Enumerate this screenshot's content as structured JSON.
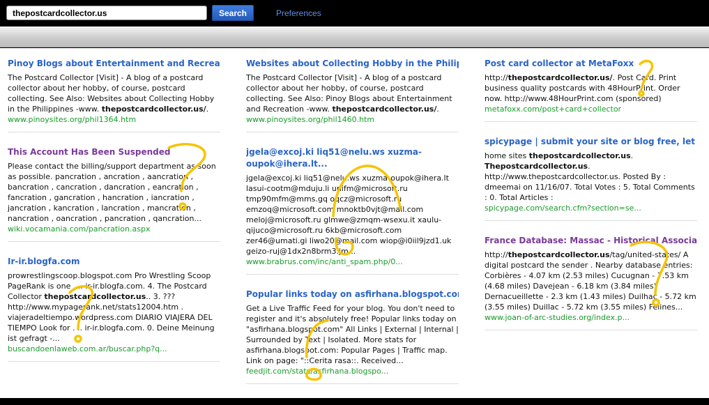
{
  "search": {
    "value": "thepostcardcollector.us",
    "button_label": "Search",
    "preferences_label": "Preferences"
  },
  "colors": {
    "link": "#2a64c6",
    "visited": "#7a3a9a",
    "url": "#1a9a2a",
    "annotation": "#f5c400",
    "button": "#2f6bd0"
  },
  "results": [
    {
      "title": "Pinoy Blogs about Entertainment and Recreation",
      "visited": false,
      "snippet": [
        {
          "t": "The Postcard Collector [Visit] - A blog of a postcard collector about her hobby, of course, postcard collecting. See Also: Websites about Collecting Hobby in the Philippines -www. "
        },
        {
          "t": "thepostcardcollector.us/",
          "b": true
        },
        {
          "t": "."
        }
      ],
      "url": "www.pinoysites.org/phil1364.htm"
    },
    {
      "title": "This Account Has Been Suspended",
      "visited": true,
      "snippet": [
        {
          "t": "Please contact the billing/support department as soon as possible. pancration , ancration , aancration , bancration , cancration , dancration , eancration , fancration , gancration , hancration , iancration , jancration , kancration , lancration , mancration , nancration , oancration , pancration , qancration..."
        }
      ],
      "url": "wiki.vocamania.com/pancration.aspx"
    },
    {
      "title": "Ir-ir.blogfa.com",
      "visited": false,
      "snippet": [
        {
          "t": "prowrestlingscoop.blogspot.com Pro Wrestling Scoop PageRank is one . .. ir-ir.blogfa.com. 4. The Postcard Collector "
        },
        {
          "t": "thepostcardcollector.us",
          "b": true
        },
        {
          "t": ".. 3. ??? http://www.mypagerank.net/stats12004.htm . viajeradeltiempo.wordpress.com DIARIO VIAJERA DEL TIEMPO Look for . .. ir-ir.blogfa.com. 0. Deine Meinung ist gefragt -..."
        }
      ],
      "url": "buscandoenlaweb.com.ar/buscar.php?q..."
    },
    {
      "title": "Websites about Collecting Hobby in the Philippines",
      "visited": false,
      "snippet": [
        {
          "t": "The Postcard Collector [Visit] - A blog of a postcard collector about her hobby, of course, postcard collecting. See Also: Pinoy Blogs about Entertainment and Recreation -www. "
        },
        {
          "t": "thepostcardcollector.us/",
          "b": true
        },
        {
          "t": "."
        }
      ],
      "url": "www.pinoysites.org/phil1460.htm"
    },
    {
      "title": "jgela@excoj.ki liq51@nelu.ws xuzma-oupok@ihera.lt...",
      "visited": false,
      "snippet": [
        {
          "t": "jgela@excoj.ki liq51@nelu.ws xuzma-oupok@ihera.lt lasui-cootm@mduju.li unifm@microsoft.ru tmp90mfm@mms.gq oqcz@microsoft.ru emzoq@microsoft.com mnoktb0vjt@mail.com meloj@microsoft.ru glmwe@zmqm-wsexu.it xaulu-qijuco@microsoft.ru 6kb@microsoft.com zer46@umati.gi liwo20@mail.com wiop@i0iil9jzd1.uk geizo-ruj@1dx2n8brm3.jm..."
        }
      ],
      "url": "www.brabrus.com/inc/anti_spam.php/0..."
    },
    {
      "title": "Popular links today on asfirhana.blogspot.com",
      "visited": false,
      "snippet": [
        {
          "t": "Get a Live Traffic Feed for your blog. You don't need to register and it's absolutely free! Popular links today on \"asfirhana.blogspot.com\" All Links | External | Internal | Surrounded by Text | Isolated. More stats for asfirhana.blogspot.com: Popular Pages | Traffic map. Link on page: \"::Cerita rasa::. Received..."
        }
      ],
      "url": "feedjit.com/stats/asfirhana.blogspo..."
    },
    {
      "title": "Post card collector at MetaFoxx",
      "visited": false,
      "snippet": [
        {
          "t": "http://"
        },
        {
          "t": "thepostcardcollector.us/",
          "b": true
        },
        {
          "t": ". Post Card. Print business quality postcards with 48HourPrint. Order now. http://www.48HourPrint.com (sponsored)"
        }
      ],
      "url": "metafoxx.com/post+card+collector"
    },
    {
      "title": "spicypage | submit your site or blog free, let ...",
      "visited": false,
      "snippet": [
        {
          "t": "home sites "
        },
        {
          "t": "thepostcardcollector.us",
          "b": true
        },
        {
          "t": ". "
        },
        {
          "t": "Thepostcardcollector.us",
          "b": true
        },
        {
          "t": ". http://www.thepostcardcollector.us. Posted By : dmeemai on 11/16/07. Total Votes : 5. Total Comments : 0. Total Articles :"
        }
      ],
      "url": "spicypage.com/search.cfm?section=se..."
    },
    {
      "title": "France Database: Massac - Historical Associa ...",
      "visited": true,
      "snippet": [
        {
          "t": "http://"
        },
        {
          "t": "thepostcardcollector.us",
          "b": true
        },
        {
          "t": "/tag/united-states/ A digital postcard the sender . Nearby database entries: Corbières - 4.07 km (2.53 miles) Cucugnan - 7.53 km (4.68 miles) Davejean - 6.18 km (3.84 miles) Dernacueillette - 2.3 km (1.43 miles) Duilhac - 5.72 km (3.55 miles) Duillac - 5.72 km (3.55 miles) Felines..."
        }
      ],
      "url": "www.joan-of-arc-studies.org/index.p..."
    }
  ]
}
